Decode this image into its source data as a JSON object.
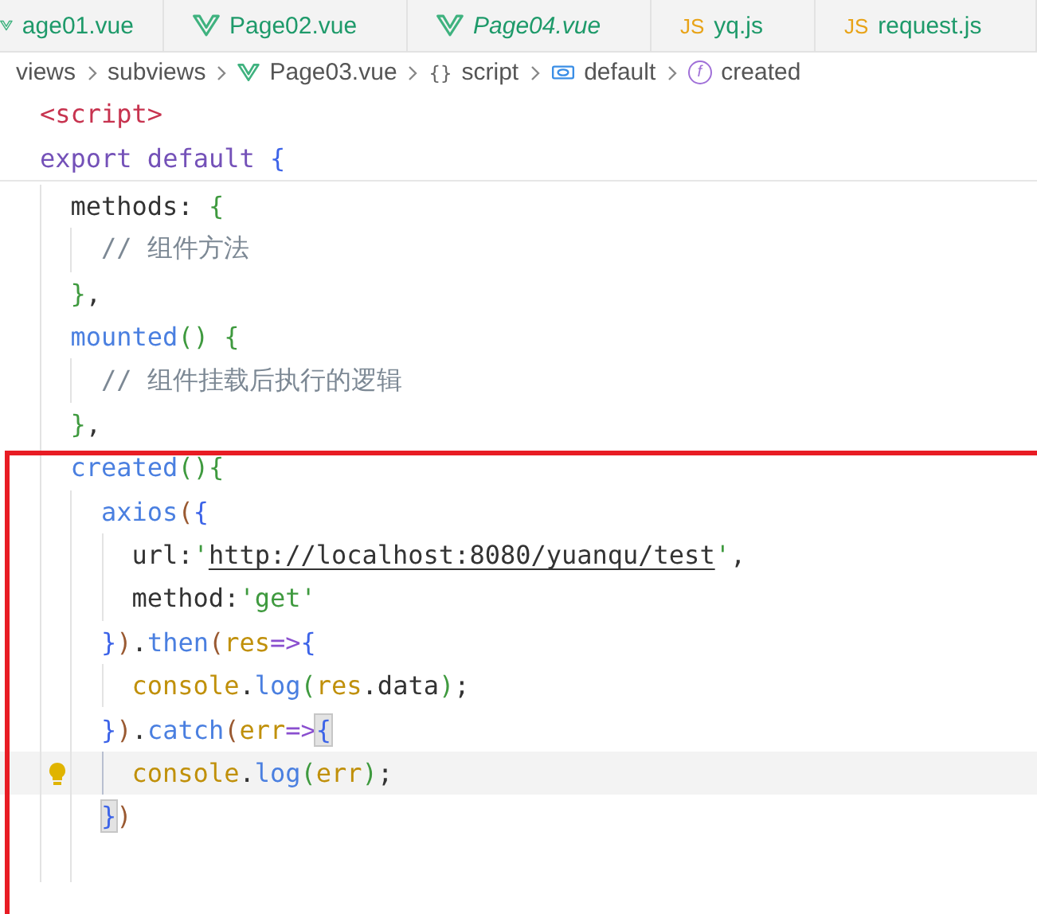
{
  "tabs": [
    {
      "label": "age01.vue",
      "kind": "vue",
      "preview": false
    },
    {
      "label": "Page02.vue",
      "kind": "vue",
      "preview": false
    },
    {
      "label": "Page04.vue",
      "kind": "vue",
      "preview": true
    },
    {
      "label": "yq.js",
      "kind": "js",
      "glyph": "JS",
      "preview": false
    },
    {
      "label": "request.js",
      "kind": "js",
      "glyph": "JS",
      "preview": false
    }
  ],
  "breadcrumb": [
    {
      "label": "views"
    },
    {
      "label": "subviews"
    },
    {
      "label": "Page03.vue",
      "kind": "vue"
    },
    {
      "label": "script",
      "kind": "braces",
      "glyph": "{}"
    },
    {
      "label": "default",
      "kind": "object"
    },
    {
      "label": "created",
      "kind": "function",
      "glyph": "f"
    }
  ],
  "sticky_lines": [
    {
      "tokens": [
        {
          "text": "<script>",
          "kind": "tag"
        }
      ]
    },
    {
      "tokens": [
        {
          "text": "export default ",
          "kind": "keyword"
        },
        {
          "text": "{",
          "kind": "brace1"
        }
      ]
    }
  ],
  "lines": [
    {
      "kind": "code",
      "tokens": [
        {
          "text": "methods: ",
          "kind": "plain"
        },
        {
          "text": "{",
          "kind": "brace2"
        }
      ],
      "children": [
        {
          "kind": "code",
          "tokens": [
            {
              "text": "// 组件方法",
              "kind": "comment"
            }
          ]
        }
      ]
    },
    {
      "kind": "code",
      "tokens": [
        {
          "text": "}",
          "kind": "brace2"
        },
        {
          "text": ",",
          "kind": "plain"
        }
      ]
    },
    {
      "kind": "code",
      "tokens": [
        {
          "text": "mounted",
          "kind": "method"
        },
        {
          "text": "() {",
          "kind": "brace2"
        }
      ],
      "children": [
        {
          "kind": "code",
          "tokens": [
            {
              "text": "// 组件挂载后执行的逻辑",
              "kind": "comment"
            }
          ]
        }
      ]
    },
    {
      "kind": "code",
      "tokens": [
        {
          "text": "}",
          "kind": "brace2"
        },
        {
          "text": ",",
          "kind": "plain"
        }
      ]
    },
    {
      "kind": "code",
      "tokens": [
        {
          "text": "created",
          "kind": "method"
        },
        {
          "text": "(){",
          "kind": "brace2"
        }
      ],
      "children": [
        {
          "kind": "code",
          "tokens": [
            {
              "text": "axios",
              "kind": "method"
            },
            {
              "text": "(",
              "kind": "brace3"
            },
            {
              "text": "{",
              "kind": "brace1"
            }
          ],
          "children": [
            {
              "kind": "code",
              "tokens": [
                {
                  "text": "url:",
                  "kind": "plain"
                },
                {
                  "text": "'",
                  "kind": "string"
                },
                {
                  "text": "http://localhost:8080/yuanqu/test",
                  "kind": "link"
                },
                {
                  "text": "'",
                  "kind": "string"
                },
                {
                  "text": ",",
                  "kind": "plain"
                }
              ]
            },
            {
              "kind": "code",
              "tokens": [
                {
                  "text": "method:",
                  "kind": "plain"
                },
                {
                  "text": "'get'",
                  "kind": "string"
                }
              ]
            }
          ]
        },
        {
          "kind": "code",
          "tokens": [
            {
              "text": "}",
              "kind": "brace1"
            },
            {
              "text": ")",
              "kind": "brace3"
            },
            {
              "text": ".",
              "kind": "plain"
            },
            {
              "text": "then",
              "kind": "method"
            },
            {
              "text": "(",
              "kind": "brace3"
            },
            {
              "text": "res",
              "kind": "param"
            },
            {
              "text": "=>",
              "kind": "operator"
            },
            {
              "text": "{",
              "kind": "brace1"
            }
          ],
          "children": [
            {
              "kind": "code",
              "tokens": [
                {
                  "text": "console",
                  "kind": "param"
                },
                {
                  "text": ".",
                  "kind": "plain"
                },
                {
                  "text": "log",
                  "kind": "method"
                },
                {
                  "text": "(",
                  "kind": "brace2"
                },
                {
                  "text": "res",
                  "kind": "param"
                },
                {
                  "text": ".data",
                  "kind": "plain"
                },
                {
                  "text": ")",
                  "kind": "brace2"
                },
                {
                  "text": ";",
                  "kind": "plain"
                }
              ]
            }
          ]
        },
        {
          "kind": "code",
          "tokens": [
            {
              "text": "}",
              "kind": "brace1"
            },
            {
              "text": ")",
              "kind": "brace3"
            },
            {
              "text": ".",
              "kind": "plain"
            },
            {
              "text": "catch",
              "kind": "method"
            },
            {
              "text": "(",
              "kind": "brace3"
            },
            {
              "text": "err",
              "kind": "param"
            },
            {
              "text": "=>",
              "kind": "operator"
            },
            {
              "text": "{",
              "kind": "brace1",
              "matched": true
            }
          ],
          "children": [
            {
              "kind": "code",
              "current": true,
              "lightbulb": true,
              "tokens": [
                {
                  "text": "console",
                  "kind": "param"
                },
                {
                  "text": ".",
                  "kind": "plain"
                },
                {
                  "text": "log",
                  "kind": "method"
                },
                {
                  "text": "(",
                  "kind": "brace2"
                },
                {
                  "text": "err",
                  "kind": "param"
                },
                {
                  "text": ")",
                  "kind": "brace2"
                },
                {
                  "text": ";",
                  "kind": "plain"
                }
              ]
            }
          ]
        },
        {
          "kind": "code",
          "tokens": [
            {
              "text": "}",
              "kind": "brace1",
              "matched": true
            },
            {
              "text": ")",
              "kind": "brace3"
            }
          ]
        },
        {
          "kind": "blank"
        }
      ]
    }
  ]
}
